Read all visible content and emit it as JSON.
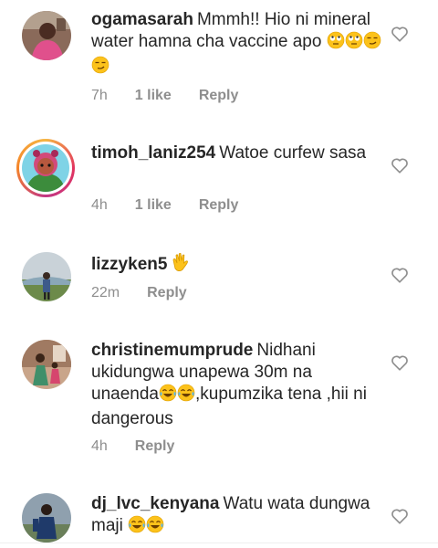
{
  "comments": [
    {
      "username": "ogamasarah",
      "text": "Mmmh!! Hio ni mineral water hamna cha vaccine apo",
      "emoji": [
        "rolling-eyes",
        "rolling-eyes",
        "smirk",
        "smirk"
      ],
      "time": "7h",
      "likes": "1 like",
      "reply": "Reply"
    },
    {
      "username": "timoh_laniz254",
      "text": "Watoe curfew sasa",
      "emoji": [],
      "time": "4h",
      "likes": "1 like",
      "reply": "Reply"
    },
    {
      "username": "lizzyken5",
      "text": "",
      "emoji": [
        "clapping-hands"
      ],
      "time": "22m",
      "likes": "",
      "reply": "Reply"
    },
    {
      "username": "christinemumprude",
      "text_part1": "Nidhani ukidungwa unapewa 30m na unaenda",
      "emoji": [
        "tears-of-joy",
        "tears-of-joy"
      ],
      "text_part2": ",kupumzika tena ,hii ni dangerous",
      "time": "4h",
      "likes": "",
      "reply": "Reply"
    },
    {
      "username": "dj_lvc_kenyana",
      "text": "Watu wata dungwa maji",
      "emoji": [
        "tears-of-joy",
        "tears-of-joy"
      ],
      "time": "",
      "likes": "",
      "reply": ""
    }
  ]
}
